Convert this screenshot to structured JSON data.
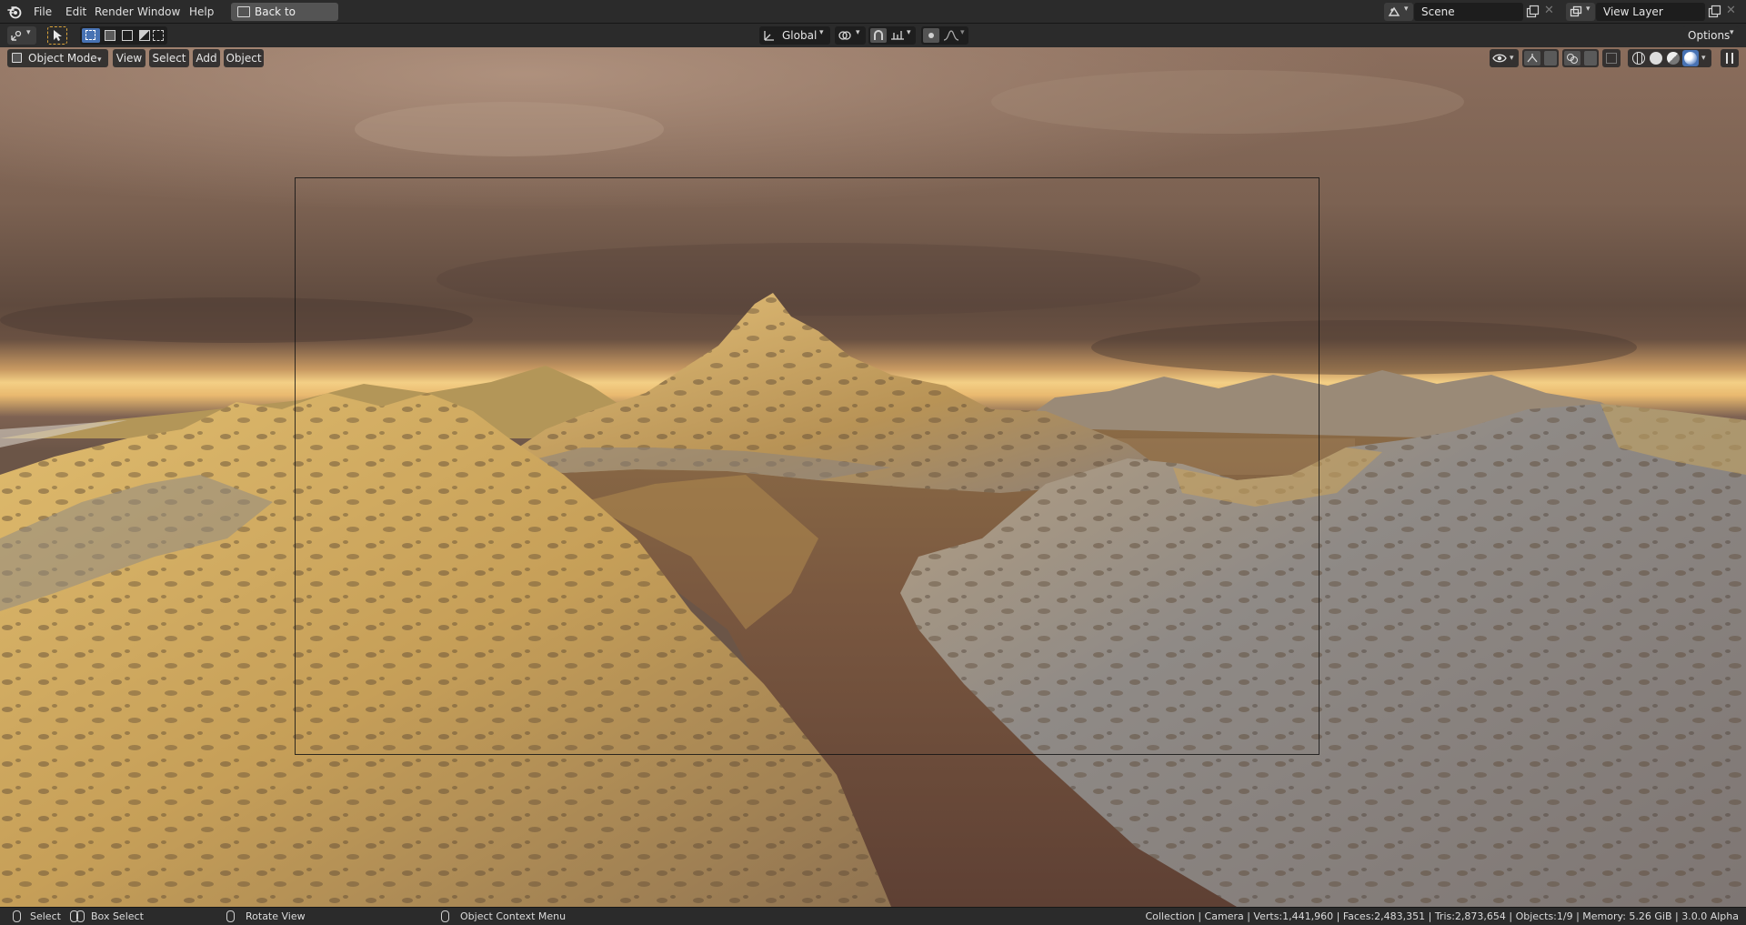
{
  "menubar": {
    "items": [
      "File",
      "Edit",
      "Render",
      "Window",
      "Help"
    ],
    "back_button": "Back to Previous",
    "scene_name": "Scene",
    "view_layer_name": "View Layer"
  },
  "toolbar": {
    "transform_orientation": "Global",
    "options_label": "Options"
  },
  "viewport_header": {
    "mode": "Object Mode",
    "menus": [
      "View",
      "Select",
      "Add",
      "Object"
    ]
  },
  "statusbar": {
    "select_label": "Select",
    "box_select_label": "Box Select",
    "rotate_view_label": "Rotate View",
    "context_menu_label": "Object Context Menu",
    "stats": "Collection | Camera | Verts:1,441,960 | Faces:2,483,351 | Tris:2,873,654 | Objects:1/9 | Memory: 5.26 GiB | 3.0.0 Alpha"
  },
  "colors": {
    "accent_blue": "#4772b3",
    "header_bg": "#2b2b2b",
    "sky_dark": "#5e4a3e",
    "sky_glow": "#f3c97a",
    "rock_gold": "#c9a45a",
    "rock_grey": "#8d8a88",
    "water": "#6b4a3c"
  }
}
